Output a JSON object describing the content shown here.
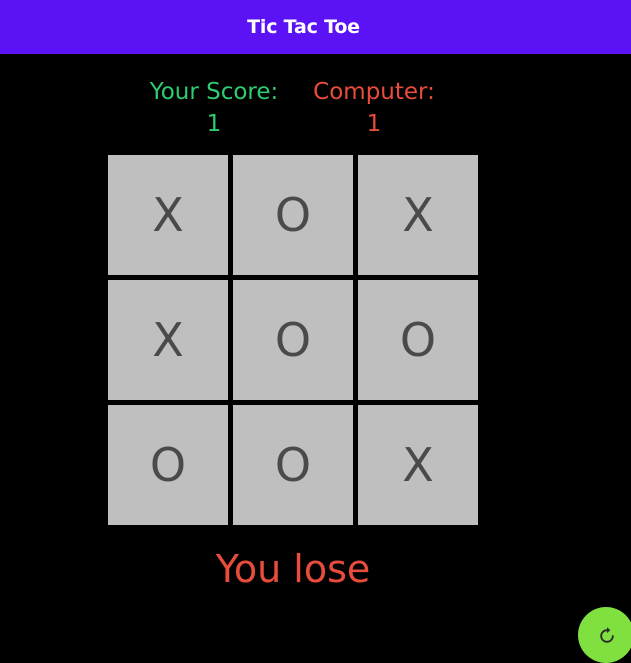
{
  "app_bar": {
    "title": "Tic Tac Toe",
    "color": "#5b12f5"
  },
  "scores": {
    "player": {
      "label": "Your Score:",
      "value": "1",
      "color": "#2ecc71"
    },
    "computer": {
      "label": "Computer:",
      "value": "1",
      "color": "#e74c3c"
    }
  },
  "board": {
    "cells": [
      "X",
      "O",
      "X",
      "X",
      "O",
      "O",
      "O",
      "O",
      "X"
    ]
  },
  "result": {
    "text": "You lose",
    "color": "#e74c3c"
  },
  "restart_button": {
    "icon": "refresh-icon",
    "color": "#7fe040"
  }
}
